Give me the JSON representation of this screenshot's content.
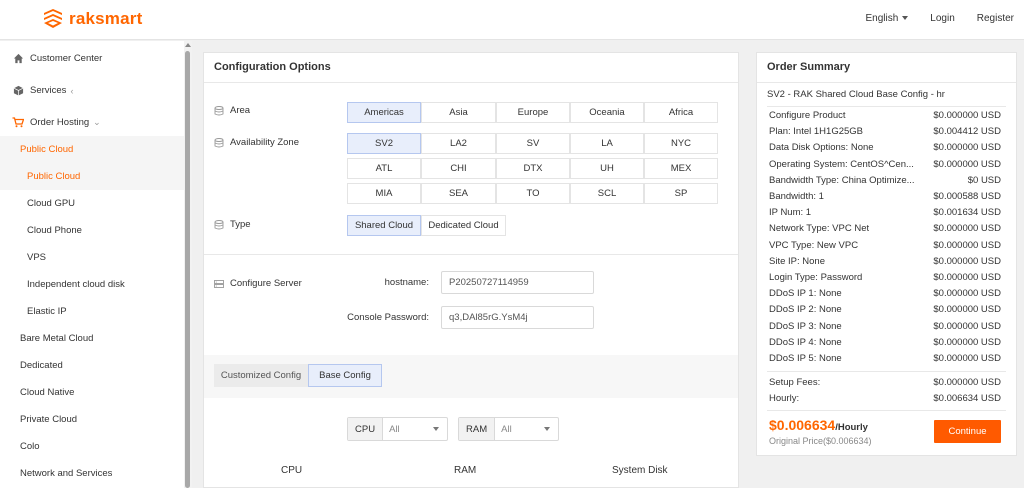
{
  "brand": {
    "name": "raksmart",
    "accent": "#ff6600"
  },
  "top_nav": {
    "language": "English",
    "login": "Login",
    "register": "Register"
  },
  "sidebar": {
    "items": [
      {
        "label": "Customer Center",
        "icon": "home-icon"
      },
      {
        "label": "Services",
        "icon": "cube-icon"
      },
      {
        "label": "Order Hosting",
        "icon": "cart-icon"
      },
      {
        "label": "Public Cloud"
      },
      {
        "label": "Public Cloud"
      },
      {
        "label": "Cloud GPU"
      },
      {
        "label": "Cloud Phone"
      },
      {
        "label": "VPS"
      },
      {
        "label": "Independent cloud disk"
      },
      {
        "label": "Elastic IP"
      },
      {
        "label": "Bare Metal Cloud"
      },
      {
        "label": "Dedicated"
      },
      {
        "label": "Cloud Native"
      },
      {
        "label": "Private Cloud"
      },
      {
        "label": "Colo"
      },
      {
        "label": "Network and Services"
      }
    ]
  },
  "config": {
    "title": "Configuration Options",
    "area": {
      "label": "Area",
      "options": [
        "Americas",
        "Asia",
        "Europe",
        "Oceania",
        "Africa"
      ],
      "selected": "Americas"
    },
    "zone": {
      "label": "Availability Zone",
      "options": [
        "SV2",
        "LA2",
        "SV",
        "LA",
        "NYC",
        "ATL",
        "CHI",
        "DTX",
        "UH",
        "MEX",
        "MIA",
        "SEA",
        "TO",
        "SCL",
        "SP"
      ],
      "selected": "SV2"
    },
    "type": {
      "label": "Type",
      "options": [
        "Shared Cloud",
        "Dedicated Cloud"
      ],
      "selected": "Shared Cloud"
    },
    "server": {
      "label": "Configure Server",
      "hostname_label": "hostname:",
      "hostname_value": "P20250727114959",
      "password_label": "Console Password:",
      "password_value": "q3,DAl85rG.YsM4j"
    },
    "tabs": [
      "Customized Config",
      "Base Config"
    ],
    "tab_selected": "Base Config",
    "filters": [
      {
        "label": "CPU",
        "value": "All"
      },
      {
        "label": "RAM",
        "value": "All"
      }
    ],
    "columns": [
      "CPU",
      "RAM",
      "System Disk"
    ]
  },
  "summary": {
    "title": "Order Summary",
    "subtitle": "SV2 - RAK Shared Cloud Base Config - hr",
    "rows": [
      {
        "label": "Configure Product",
        "value": "$0.000000 USD"
      },
      {
        "label": "Plan: Intel 1H1G25GB",
        "value": "$0.004412 USD"
      },
      {
        "label": "Data Disk Options: None",
        "value": "$0.000000 USD"
      },
      {
        "label": "Operating System: CentOS^Cen...",
        "value": "$0.000000 USD"
      },
      {
        "label": "Bandwidth Type: China Optimize...",
        "value": "$0 USD"
      },
      {
        "label": "Bandwidth: 1",
        "value": "$0.000588 USD"
      },
      {
        "label": "IP Num: 1",
        "value": "$0.001634 USD"
      },
      {
        "label": "Network Type: VPC Net",
        "value": "$0.000000 USD"
      },
      {
        "label": "VPC Type: New VPC",
        "value": "$0.000000 USD"
      },
      {
        "label": "Site IP: None",
        "value": "$0.000000 USD"
      },
      {
        "label": "Login Type: Password",
        "value": "$0.000000 USD"
      },
      {
        "label": "DDoS IP 1: None",
        "value": "$0.000000 USD"
      },
      {
        "label": "DDoS IP 2: None",
        "value": "$0.000000 USD"
      },
      {
        "label": "DDoS IP 3: None",
        "value": "$0.000000 USD"
      },
      {
        "label": "DDoS IP 4: None",
        "value": "$0.000000 USD"
      },
      {
        "label": "DDoS IP 5: None",
        "value": "$0.000000 USD"
      }
    ],
    "setup_label": "Setup Fees:",
    "setup_value": "$0.000000 USD",
    "hourly_label": "Hourly:",
    "hourly_value": "$0.006634 USD",
    "price": "$0.006634",
    "price_unit": "/Hourly",
    "original_price": "Original Price($0.006634)",
    "continue_label": "Continue"
  }
}
